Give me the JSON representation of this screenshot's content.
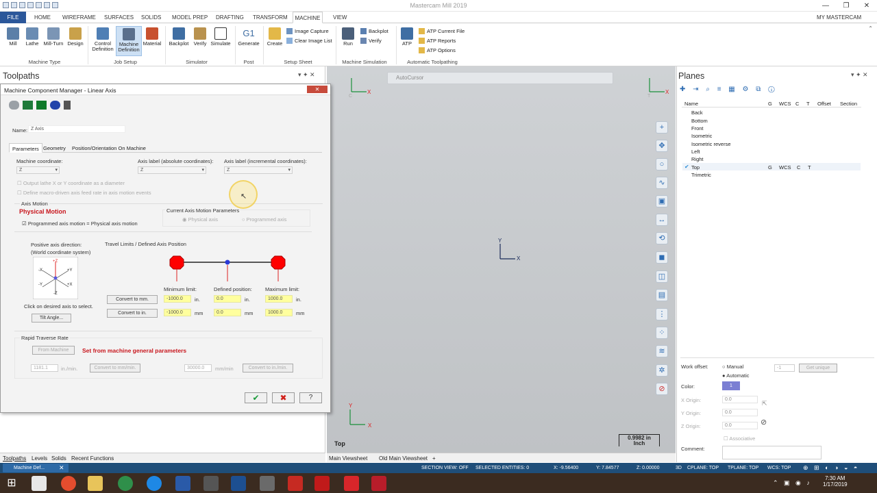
{
  "app": {
    "title": "Mastercam Mill 2019",
    "my_mastercam": "MY MASTERCAM",
    "window_controls": [
      "—",
      "❐",
      "✕"
    ]
  },
  "ribbon_tabs": [
    "FILE",
    "HOME",
    "WIREFRAME",
    "SURFACES",
    "SOLIDS",
    "MODEL PREP",
    "DRAFTING",
    "TRANSFORM",
    "MACHINE",
    "VIEW"
  ],
  "ribbon": {
    "machine_type": {
      "label": "Machine Type",
      "items": [
        "Mill",
        "Lathe",
        "Mill-Turn",
        "Design"
      ]
    },
    "job_setup": {
      "label": "Job Setup",
      "items": [
        "Control Definition",
        "Machine Definition",
        "Material"
      ]
    },
    "simulator": {
      "label": "Simulator",
      "items": [
        "Backplot",
        "Verify",
        "Simulate"
      ]
    },
    "post": {
      "label": "Post",
      "items": [
        "Generate"
      ],
      "icon_text": "G1"
    },
    "setup_sheet": {
      "label": "Setup Sheet",
      "items": [
        "Create"
      ],
      "small": [
        "Image Capture",
        "Clear Image List"
      ]
    },
    "machine_simulation": {
      "label": "Machine Simulation",
      "items": [
        "Run"
      ],
      "small": [
        "Backplot",
        "Verify"
      ]
    },
    "automatic_toolpathing": {
      "label": "Automatic Toolpathing",
      "items": [
        "ATP"
      ],
      "small": [
        "ATP Current File",
        "ATP Reports",
        "ATP Options"
      ]
    }
  },
  "toolpaths_panel": {
    "title": "Toolpaths"
  },
  "dialog": {
    "title": "Machine Component Manager - Linear Axis",
    "name_label": "Name:",
    "name_value": "Z Axis",
    "tabs": [
      "Parameters",
      "Geometry",
      "Position/Orientation On Machine"
    ],
    "machine_coordinate_label": "Machine coordinate:",
    "machine_coordinate_value": "Z",
    "axis_label_abs_label": "Axis label (absolute coordinates):",
    "axis_label_abs_value": "Z",
    "axis_label_inc_label": "Axis label (incremental coordinates):",
    "axis_label_inc_value": "Z",
    "output_lathe": "Output lathe X or Y coordinate as a diameter",
    "define_macro": "Define macro-driven axis feed rate in axis motion events",
    "axis_motion_label": "Axis Motion",
    "physical_motion": "Physical Motion",
    "programmed_axis_motion": "Programmed axis motion = Physical axis motion",
    "current_axis_motion": "Current Axis Motion Parameters",
    "physical_axis": "Physical axis",
    "programmed_axis": "Programmed axis",
    "positive_axis_direction": "Positive axis direction:",
    "world_coord": "(World coordinate system)",
    "axis_glyphs": {
      "pz": "+Z",
      "mz": "-Z",
      "px": "+X",
      "mx": "-X",
      "py": "+Y",
      "my": "-Y"
    },
    "click_axis": "Click on desired axis to select.",
    "tilt_angle": "Tilt Angle...",
    "travel_limits": "Travel Limits / Defined Axis Position",
    "minimum_limit": "Minimum limit:",
    "defined_position": "Defined position:",
    "maximum_limit": "Maximum limit:",
    "convert_to_mm": "Convert to mm.",
    "convert_to_in": "Convert to in.",
    "min_in": "-1000.0",
    "def_in": "0.0",
    "max_in": "1000.0",
    "min_mm": "-1000.0",
    "def_mm": "0.0",
    "max_mm": "1000.0",
    "unit_in": "in.",
    "unit_mm": "mm",
    "rapid_traverse": "Rapid Traverse Rate",
    "from_machine": "From Machine",
    "set_from_machine": "Set from machine general parameters",
    "rapid_in": "1181.1",
    "rapid_in_unit": "in./min.",
    "convert_to_mm_min": "Convert to mm/min.",
    "rapid_mm": "30000.0",
    "rapid_mm_unit": "mm/min",
    "convert_to_in_min": "Convert to in./min."
  },
  "viewport": {
    "autocursor": "AutoCursor",
    "view_name": "Top",
    "scale_value": "0.9982 in",
    "scale_unit": "Inch",
    "axis_x": "X",
    "axis_y": "Y",
    "corner_c": "C",
    "corner_t": "T"
  },
  "planes_panel": {
    "title": "Planes",
    "columns": [
      "Name",
      "G",
      "WCS",
      "C",
      "T",
      "Offset",
      "Section"
    ],
    "rows": [
      {
        "name": "Back"
      },
      {
        "name": "Bottom"
      },
      {
        "name": "Front"
      },
      {
        "name": "Isometric"
      },
      {
        "name": "Isometric reverse"
      },
      {
        "name": "Left"
      },
      {
        "name": "Right"
      },
      {
        "name": "Top",
        "g": "G",
        "wcs": "WCS",
        "c": "C",
        "t": "T"
      },
      {
        "name": "Trimetric"
      }
    ],
    "work_offset_label": "Work offset:",
    "manual": "Manual",
    "automatic": "Automatic",
    "offset_value": "-1",
    "get_unique": "Get unique",
    "color_label": "Color:",
    "color_value": "1",
    "x_origin": "X Origin:",
    "y_origin": "Y Origin:",
    "z_origin": "Z Origin:",
    "origin_value": "0.0",
    "associative": "Associative",
    "comment_label": "Comment:"
  },
  "bottom_tabs_left": [
    "Toolpaths",
    "Levels",
    "Solids",
    "Recent Functions"
  ],
  "viewsheets": [
    "Main Viewsheet",
    "Old Main Viewsheet",
    "+"
  ],
  "status_bar": {
    "section_view": "SECTION VIEW: OFF",
    "selected": "SELECTED ENTITIES: 0",
    "x": "X:   -9.56400",
    "y": "Y:   7.84577",
    "z": "Z:   0.00000",
    "mode": "3D",
    "cplane": "CPLANE: TOP",
    "tplane": "TPLANE: TOP",
    "wcs": "WCS: TOP"
  },
  "taskbar": {
    "time": "7:30 AM",
    "date": "1/17/2019",
    "active_window": "Machine Def..."
  }
}
